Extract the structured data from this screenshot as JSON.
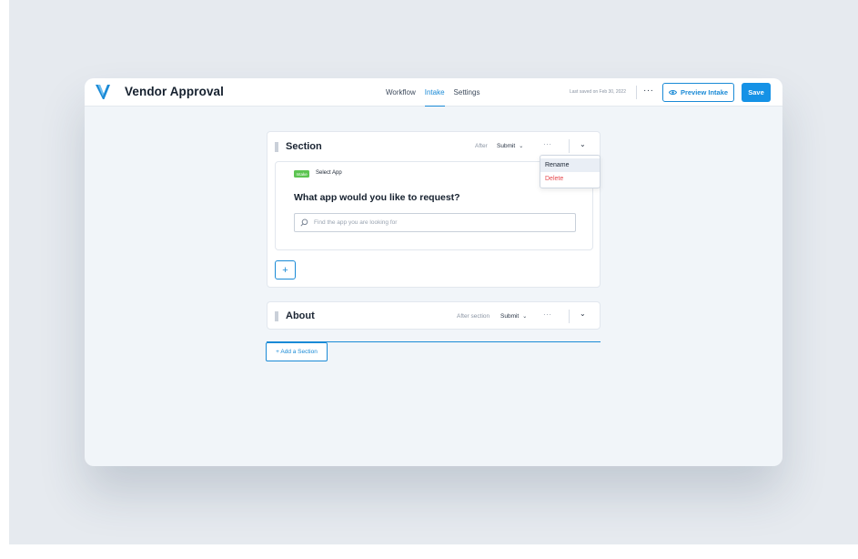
{
  "app": {
    "title": "Vendor Approval",
    "logo": "v-logo",
    "accent_color": "#1a8ad6"
  },
  "nav": {
    "tabs": [
      {
        "label": "Workflow",
        "active": false
      },
      {
        "label": "Intake",
        "active": true
      },
      {
        "label": "Settings",
        "active": false
      }
    ]
  },
  "toolbar": {
    "last_saved": "Last saved on Feb 30, 2022",
    "more_label": "···",
    "preview_label": "Preview Intake",
    "preview_icon": "eye-icon",
    "save_label": "Save"
  },
  "sections": [
    {
      "title": "Section",
      "after_label": "After",
      "submit_value": "Submit",
      "more_label": "···",
      "expanded": true,
      "question": {
        "badge": "Intake",
        "type_label": "Select App",
        "text": "What app would you like to request?",
        "placeholder": "Find the app you are looking for"
      },
      "add_label": "+"
    },
    {
      "title": "About",
      "after_label": "After section",
      "submit_value": "Submit",
      "more_label": "···",
      "expanded": false
    }
  ],
  "context_menu": {
    "items": [
      {
        "label": "Rename",
        "highlighted": true
      },
      {
        "label": "Delete",
        "color": "#e5484d"
      }
    ]
  },
  "add_section_label": "+ Add a Section"
}
